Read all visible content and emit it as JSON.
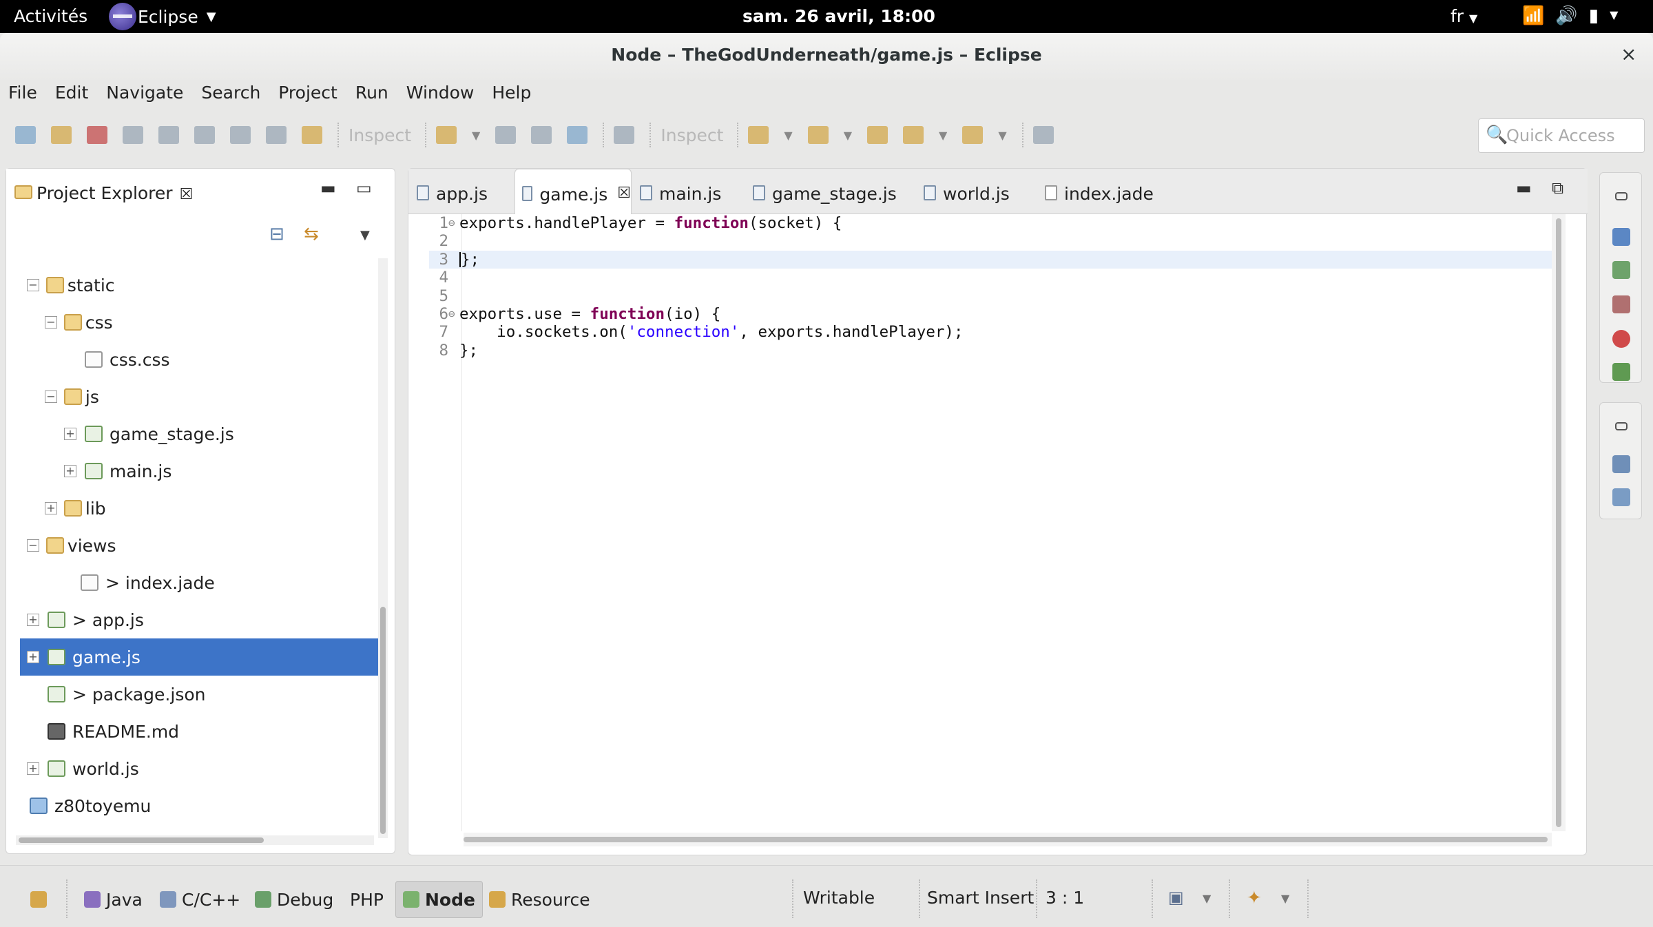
{
  "system": {
    "activities": "Activités",
    "app_name": "Eclipse",
    "clock": "sam. 26 avril, 18:00",
    "lang": "fr"
  },
  "window": {
    "title": "Node – TheGodUnderneath/game.js – Eclipse",
    "close": "×"
  },
  "menu": [
    "File",
    "Edit",
    "Navigate",
    "Search",
    "Project",
    "Run",
    "Window",
    "Help"
  ],
  "toolbar": {
    "inspect_1": "Inspect",
    "inspect_2": "Inspect",
    "quick_access_placeholder": "Quick Access"
  },
  "explorer": {
    "title": "Project Explorer",
    "close": "☒",
    "tree": [
      {
        "label": "> static",
        "expander": "−",
        "icon": "folder-icon"
      },
      {
        "label": "> css",
        "expander": "−",
        "icon": "folder-icon"
      },
      {
        "label": "css.css",
        "expander": "",
        "icon": "css-file-icon"
      },
      {
        "label": "> js",
        "expander": "−",
        "icon": "folder-icon"
      },
      {
        "label": "game_stage.js",
        "expander": "+",
        "icon": "js-file-icon"
      },
      {
        "label": "main.js",
        "expander": "+",
        "icon": "js-file-icon"
      },
      {
        "label": "> lib",
        "expander": "+",
        "icon": "folder-icon"
      },
      {
        "label": "> views",
        "expander": "−",
        "icon": "folder-icon"
      },
      {
        "label": "> index.jade",
        "expander": "",
        "icon": "file-icon"
      },
      {
        "label": "> app.js",
        "expander": "+",
        "icon": "js-file-icon"
      },
      {
        "label": "game.js",
        "expander": "+",
        "icon": "js-file-icon"
      },
      {
        "label": "> package.json",
        "expander": "",
        "icon": "js-file-icon"
      },
      {
        "label": "README.md",
        "expander": "",
        "icon": "file-icon"
      },
      {
        "label": "world.js",
        "expander": "+",
        "icon": "js-file-icon"
      },
      {
        "label": "z80toyemu",
        "expander": "",
        "icon": "project-icon"
      }
    ],
    "selected_item": "game.js"
  },
  "editor": {
    "tabs": [
      {
        "label": "app.js"
      },
      {
        "label": "game.js",
        "close": "☒"
      },
      {
        "label": "main.js"
      },
      {
        "label": "game_stage.js"
      },
      {
        "label": "world.js"
      },
      {
        "label": "index.jade"
      }
    ],
    "active_tab": "game.js",
    "lines": [
      {
        "n": "1",
        "fold": "⊖",
        "text": "exports.handlePlayer = function(socket) {"
      },
      {
        "n": "2",
        "fold": "",
        "text": ""
      },
      {
        "n": "3",
        "fold": "",
        "text": "};"
      },
      {
        "n": "4",
        "fold": "",
        "text": ""
      },
      {
        "n": "5",
        "fold": "",
        "text": ""
      },
      {
        "n": "6",
        "fold": "⊖",
        "text": "exports.use = function(io) {"
      },
      {
        "n": "7",
        "fold": "",
        "text": "    io.sockets.on('connection', exports.handlePlayer);"
      },
      {
        "n": "8",
        "fold": "",
        "text": "};"
      }
    ]
  },
  "perspectives": [
    "Java",
    "C/C++",
    "Debug",
    "PHP",
    "Node",
    "Resource"
  ],
  "active_perspective": "Node",
  "status": {
    "mode": "Writable",
    "insert": "Smart Insert",
    "position": "3 : 1"
  }
}
